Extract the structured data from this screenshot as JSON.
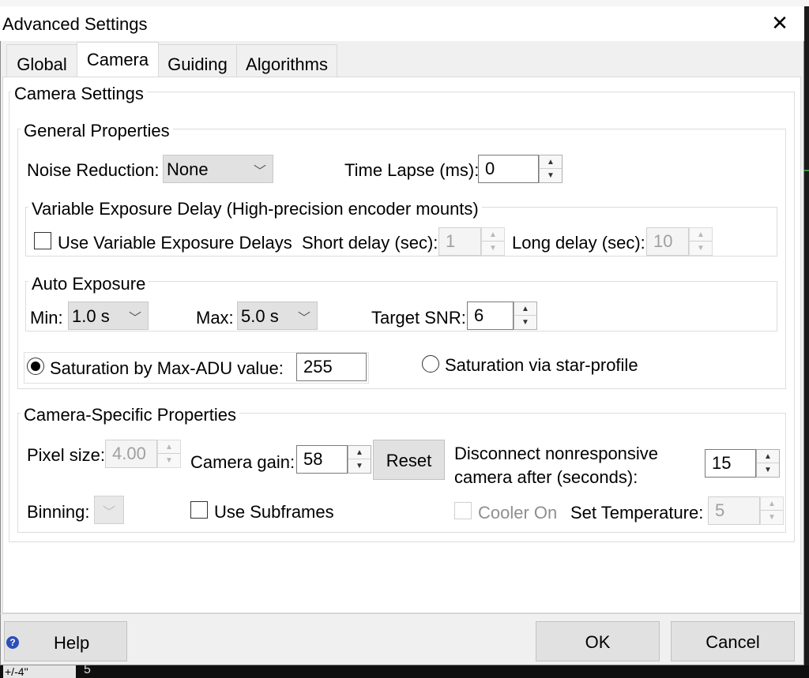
{
  "window": {
    "title": "Advanced Settings",
    "close_glyph": "✕"
  },
  "tabs": [
    "Global",
    "Camera",
    "Guiding",
    "Algorithms"
  ],
  "camera_settings": {
    "title": "Camera Settings",
    "general": {
      "title": "General Properties",
      "noise_reduction_label": "Noise Reduction:",
      "noise_reduction_value": "None",
      "time_lapse_label": "Time Lapse (ms):",
      "time_lapse_value": "0",
      "variable_delay": {
        "title": "Variable Exposure Delay (High-precision encoder mounts)",
        "use_label": "Use Variable Exposure Delays",
        "short_label": "Short delay (sec):",
        "short_value": "1",
        "long_label": "Long delay (sec):",
        "long_value": "10"
      },
      "auto_exposure": {
        "title": "Auto Exposure",
        "min_label": "Min:",
        "min_value": "1.0 s",
        "max_label": "Max:",
        "max_value": "5.0 s",
        "snr_label": "Target SNR:",
        "snr_value": "6"
      },
      "saturation_adu_label": "Saturation by Max-ADU value:",
      "saturation_adu_value": "255",
      "saturation_star_label": "Saturation via star-profile"
    },
    "specific": {
      "title": "Camera-Specific Properties",
      "pixel_size_label": "Pixel size:",
      "pixel_size_value": "4.00",
      "gain_label": "Camera gain:",
      "gain_value": "58",
      "reset_label": "Reset",
      "disconnect_label_1": "Disconnect nonresponsive",
      "disconnect_label_2": "camera after (seconds):",
      "disconnect_value": "15",
      "binning_label": "Binning:",
      "subframes_label": "Use Subframes",
      "cooler_label": "Cooler On",
      "set_temp_label": "Set Temperature:",
      "set_temp_value": "5"
    }
  },
  "buttons": {
    "help": "Help",
    "ok": "OK",
    "cancel": "Cancel"
  },
  "background": {
    "under_text_1": "+/-4''",
    "under_text_2": "5"
  }
}
